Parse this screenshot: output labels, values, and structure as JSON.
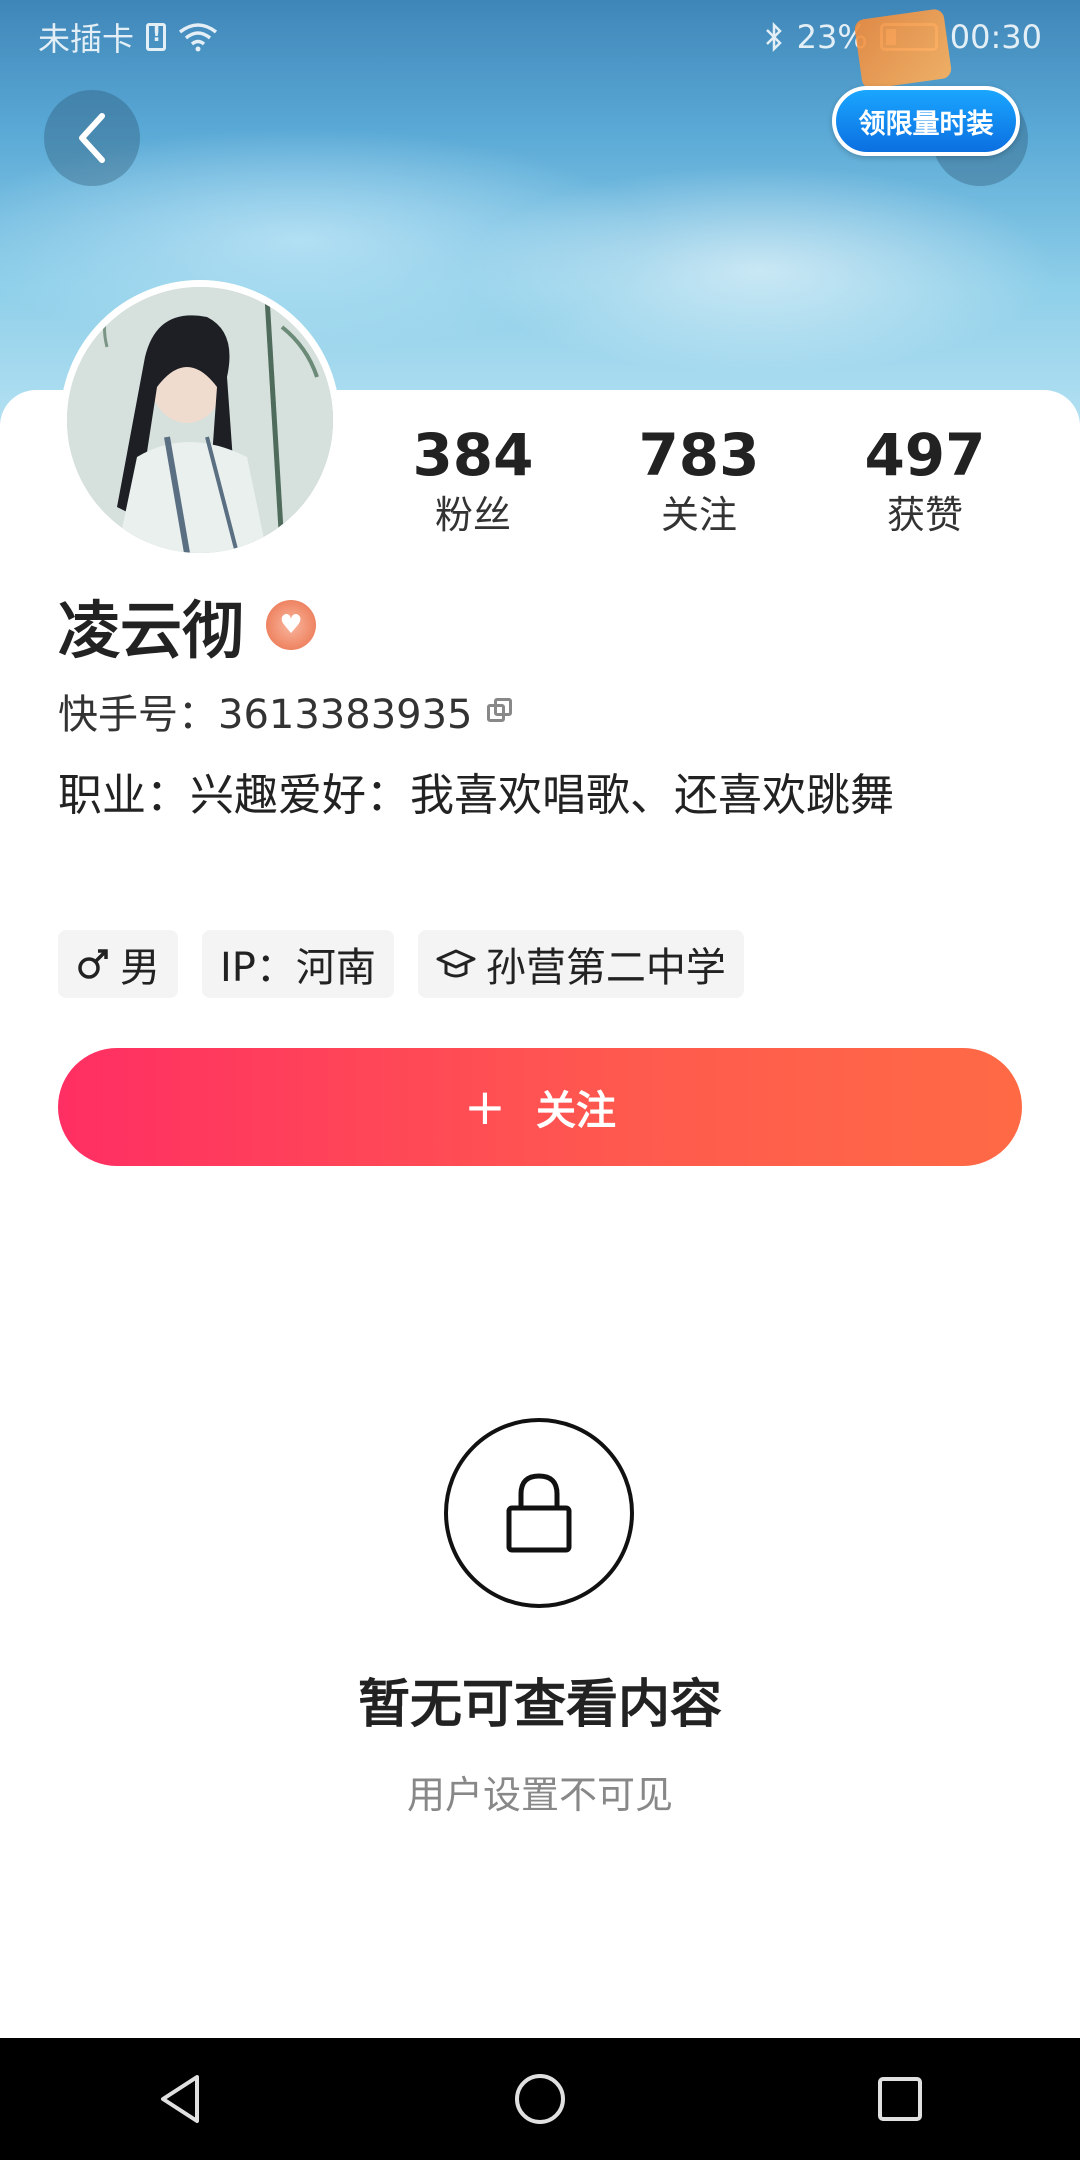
{
  "status_bar": {
    "carrier_text": "未插卡",
    "battery_percent": "23%",
    "time": "00:30"
  },
  "header": {
    "promo_label": "领限量时装"
  },
  "profile": {
    "stats": [
      {
        "value": "384",
        "label": "粉丝"
      },
      {
        "value": "783",
        "label": "关注"
      },
      {
        "value": "497",
        "label": "获赞"
      }
    ],
    "username": "凌云彻",
    "account_text": "快手号：3613383935",
    "bio": "职业：兴趣爱好：我喜欢唱歌、还喜欢跳舞",
    "tags": [
      {
        "icon": "male-icon",
        "text": "男"
      },
      {
        "icon": "",
        "text": "IP：河南"
      },
      {
        "icon": "graduation-cap-icon",
        "text": "孙营第二中学"
      }
    ],
    "follow_label": "关注"
  },
  "empty_state": {
    "title": "暂无可查看内容",
    "subtitle": "用户设置不可见"
  },
  "colors": {
    "follow_gradient_start": "#ff2e63",
    "follow_gradient_end": "#ff6a45",
    "promo_blue": "#0b6fe0"
  }
}
